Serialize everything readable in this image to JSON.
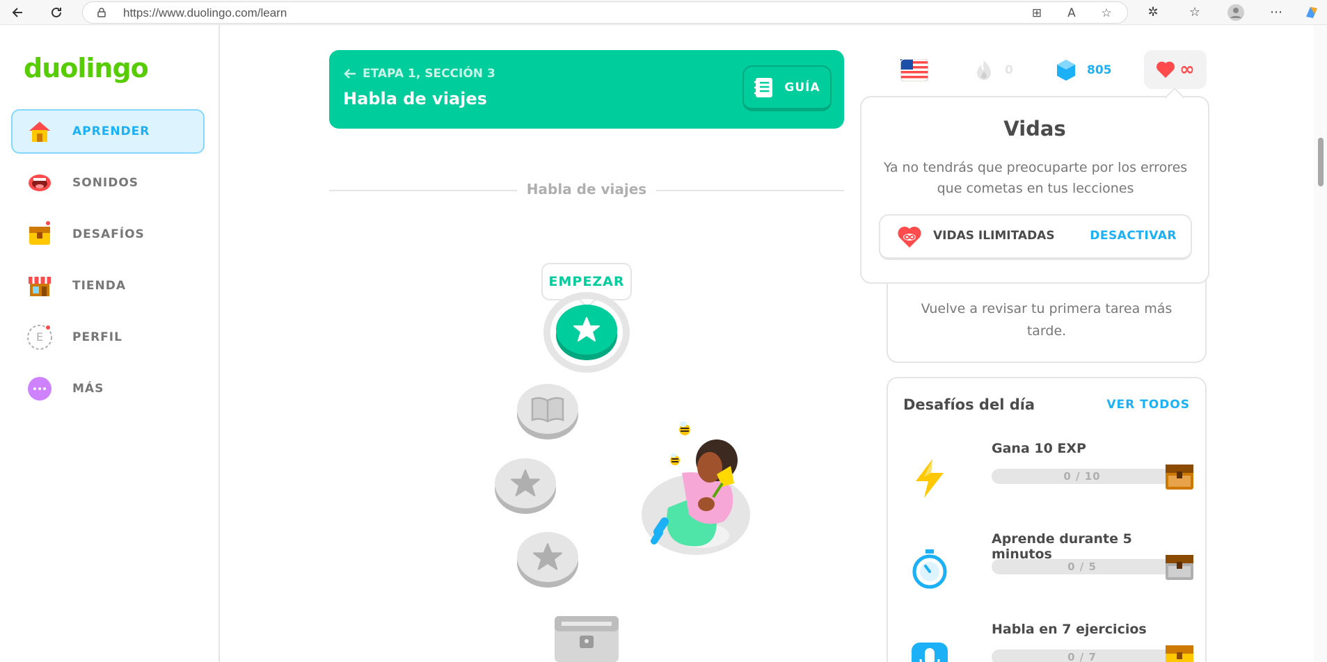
{
  "browser": {
    "url": "https://www.duolingo.com/learn",
    "icons": [
      "back-arrow-icon",
      "refresh-icon",
      "lock-icon",
      "app-grid-icon",
      "read-aloud-icon",
      "star-favorite-icon",
      "extensions-icon",
      "favorites-icon",
      "profile-icon",
      "more-icon",
      "copilot-icon"
    ]
  },
  "sidebar": {
    "logo": "duolingo",
    "items": [
      {
        "label": "APRENDER",
        "icon": "home-icon",
        "active": true
      },
      {
        "label": "SONIDOS",
        "icon": "mouth-icon"
      },
      {
        "label": "DESAFÍOS",
        "icon": "chest-icon",
        "notification": true
      },
      {
        "label": "TIENDA",
        "icon": "shop-icon"
      },
      {
        "label": "PERFIL",
        "icon": "profile-avatar-icon",
        "avatar_letter": "E",
        "notification": true
      },
      {
        "label": "MÁS",
        "icon": "more-dots-icon"
      }
    ]
  },
  "unit": {
    "section": "ETAPA 1, SECCIÓN 3",
    "title": "Habla de viajes",
    "guide_label": "GUÍA",
    "divider_text": "Habla de viajes",
    "start_label": "EMPEZAR",
    "colors": {
      "header": "#00cd9c",
      "path_active": "#00cd9c",
      "path_locked": "#e5e5e5"
    }
  },
  "stats": {
    "language": "English (US)",
    "streak": "0",
    "gems": "805",
    "hearts": "∞"
  },
  "lives_popup": {
    "title": "Vidas",
    "description": "Ya no tendrás que preocuparte por los errores que cometas en tus lecciones",
    "row_label": "VIDAS ILIMITADAS",
    "row_action": "DESACTIVAR"
  },
  "quest_card": {
    "text": "Vuelve a revisar tu primera tarea más tarde."
  },
  "daily": {
    "title": "Desafíos del día",
    "view_all": "VER TODOS",
    "quests": [
      {
        "name": "Gana 10 EXP",
        "progress": "0 / 10",
        "icon": "lightning-icon"
      },
      {
        "name": "Aprende durante 5 minutos",
        "progress": "0 / 5",
        "icon": "stopwatch-icon"
      },
      {
        "name": "Habla en 7 ejercicios",
        "progress": "0 / 7",
        "icon": "microphone-icon"
      }
    ]
  }
}
